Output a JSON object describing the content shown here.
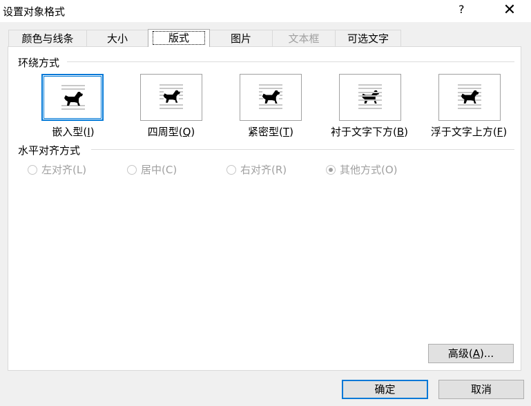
{
  "window": {
    "title": "设置对象格式",
    "help": "?",
    "close": "✕"
  },
  "tabs": [
    {
      "label": "颜色与线条"
    },
    {
      "label": "大小"
    },
    {
      "label": "版式"
    },
    {
      "label": "图片"
    },
    {
      "label": "文本框"
    },
    {
      "label": "可选文字"
    }
  ],
  "wrap": {
    "title": "环绕方式",
    "items": [
      {
        "label": "嵌入型(",
        "key": "I",
        "end": ")"
      },
      {
        "label": "四周型(",
        "key": "Q",
        "end": ")"
      },
      {
        "label": "紧密型(",
        "key": "T",
        "end": ")"
      },
      {
        "label": "衬于文字下方(",
        "key": "B",
        "end": ")"
      },
      {
        "label": "浮于文字上方(",
        "key": "F",
        "end": ")"
      }
    ]
  },
  "align": {
    "title": "水平对齐方式",
    "options": [
      {
        "label": "左对齐(L)"
      },
      {
        "label": "居中(C)"
      },
      {
        "label": "右对齐(R)"
      },
      {
        "label": "其他方式(O)"
      }
    ]
  },
  "buttons": {
    "advanced": "高级(",
    "advanced_key": "A",
    "advanced_end": ")...",
    "ok": "确定",
    "cancel": "取消"
  }
}
